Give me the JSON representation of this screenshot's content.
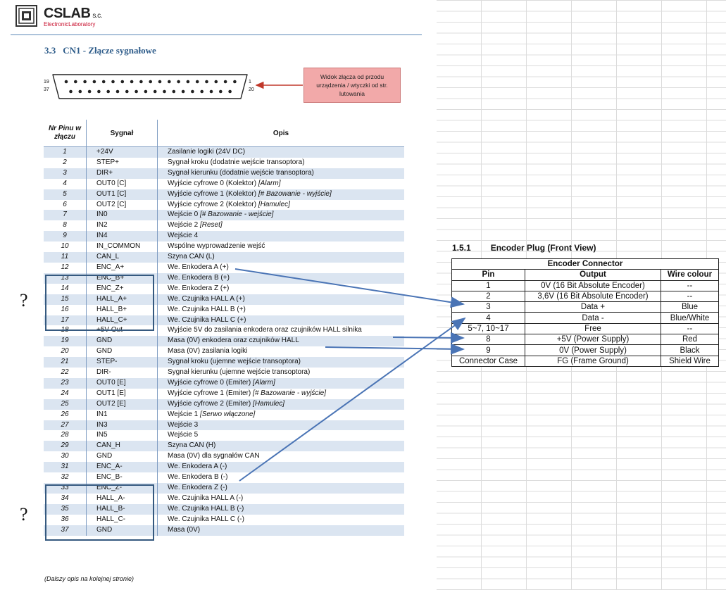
{
  "header": {
    "logo_main": "CSLAB",
    "logo_suffix": "s.c.",
    "logo_sub": "ElectronicLaboratory",
    "section_number": "3.3",
    "section_title": "CN1 - Złącze sygnałowe"
  },
  "connector": {
    "label_top_left": "19",
    "label_bottom_left": "37",
    "label_top_right": "1",
    "label_bottom_right": "20",
    "note": "Widok złącza od przodu urządzenia / wtyczki od str. lutowania",
    "top_pins": 19,
    "bottom_pins": 18
  },
  "signal_table": {
    "headers": {
      "pin": "Nr Pinu w złączu",
      "signal": "Sygnał",
      "description": "Opis"
    },
    "rows": [
      {
        "pin": "1",
        "signal": "+24V",
        "desc": "Zasilanie logiki (24V DC)",
        "extra": ""
      },
      {
        "pin": "2",
        "signal": "STEP+",
        "desc": "Sygnał kroku (dodatnie wejście transoptora)",
        "extra": ""
      },
      {
        "pin": "3",
        "signal": "DIR+",
        "desc": "Sygnał kierunku (dodatnie wejście transoptora)",
        "extra": ""
      },
      {
        "pin": "4",
        "signal": "OUT0 [C]",
        "desc": "Wyjście cyfrowe 0 (Kolektor) ",
        "extra": "[Alarm]"
      },
      {
        "pin": "5",
        "signal": "OUT1 [C]",
        "desc": "Wyjście cyfrowe 1 (Kolektor) ",
        "extra": "[# Bazowanie - wyjście]"
      },
      {
        "pin": "6",
        "signal": "OUT2 [C]",
        "desc": "Wyjście cyfrowe 2 (Kolektor) ",
        "extra": "[Hamulec]"
      },
      {
        "pin": "7",
        "signal": "IN0",
        "desc": "Wejście 0 ",
        "extra": "[# Bazowanie - wejście]"
      },
      {
        "pin": "8",
        "signal": "IN2",
        "desc": "Wejście 2 ",
        "extra": "[Reset]"
      },
      {
        "pin": "9",
        "signal": "IN4",
        "desc": "Wejście 4",
        "extra": ""
      },
      {
        "pin": "10",
        "signal": "IN_COMMON",
        "desc": "Wspólne wyprowadzenie wejść",
        "extra": ""
      },
      {
        "pin": "11",
        "signal": "CAN_L",
        "desc": "Szyna CAN (L)",
        "extra": ""
      },
      {
        "pin": "12",
        "signal": "ENC_A+",
        "desc": "We. Enkodera A (+)",
        "extra": ""
      },
      {
        "pin": "13",
        "signal": "ENC_B+",
        "desc": "We. Enkodera B (+)",
        "extra": ""
      },
      {
        "pin": "14",
        "signal": "ENC_Z+",
        "desc": "We. Enkodera Z (+)",
        "extra": ""
      },
      {
        "pin": "15",
        "signal": "HALL_A+",
        "desc": "We. Czujnika HALL A (+)",
        "extra": ""
      },
      {
        "pin": "16",
        "signal": "HALL_B+",
        "desc": "We. Czujnika HALL B (+)",
        "extra": ""
      },
      {
        "pin": "17",
        "signal": "HALL_C+",
        "desc": "We. Czujnika HALL C (+)",
        "extra": ""
      },
      {
        "pin": "18",
        "signal": "+5V Out",
        "desc": "Wyjście 5V do zasilania enkodera oraz czujników HALL silnika",
        "extra": ""
      },
      {
        "pin": "19",
        "signal": "GND",
        "desc": "Masa (0V) enkodera oraz czujników HALL",
        "extra": ""
      },
      {
        "pin": "20",
        "signal": "GND",
        "desc": "Masa (0V) zasilania logiki",
        "extra": ""
      },
      {
        "pin": "21",
        "signal": "STEP-",
        "desc": "Sygnał kroku (ujemne wejście transoptora)",
        "extra": ""
      },
      {
        "pin": "22",
        "signal": "DIR-",
        "desc": "Sygnał kierunku (ujemne wejście transoptora)",
        "extra": ""
      },
      {
        "pin": "23",
        "signal": "OUT0 [E]",
        "desc": "Wyjście cyfrowe 0 (Emiter) ",
        "extra": "[Alarm]"
      },
      {
        "pin": "24",
        "signal": "OUT1 [E]",
        "desc": "Wyjście cyfrowe 1 (Emiter) ",
        "extra": "[# Bazowanie - wyjście]"
      },
      {
        "pin": "25",
        "signal": "OUT2 [E]",
        "desc": "Wyjście cyfrowe 2 (Emiter) ",
        "extra": "[Hamulec]"
      },
      {
        "pin": "26",
        "signal": "IN1",
        "desc": "Wejście 1 ",
        "extra": "[Serwo włączone]"
      },
      {
        "pin": "27",
        "signal": "IN3",
        "desc": "Wejście 3",
        "extra": ""
      },
      {
        "pin": "28",
        "signal": "IN5",
        "desc": "Wejście 5",
        "extra": ""
      },
      {
        "pin": "29",
        "signal": "CAN_H",
        "desc": "Szyna CAN (H)",
        "extra": ""
      },
      {
        "pin": "30",
        "signal": "GND",
        "desc": "Masa (0V) dla sygnałów CAN",
        "extra": ""
      },
      {
        "pin": "31",
        "signal": "ENC_A-",
        "desc": "We. Enkodera A (-)",
        "extra": ""
      },
      {
        "pin": "32",
        "signal": "ENC_B-",
        "desc": "We. Enkodera B (-)",
        "extra": ""
      },
      {
        "pin": "33",
        "signal": "ENC_Z-",
        "desc": "We. Enkodera Z (-)",
        "extra": ""
      },
      {
        "pin": "34",
        "signal": "HALL_A-",
        "desc": "We. Czujnika HALL A (-)",
        "extra": ""
      },
      {
        "pin": "35",
        "signal": "HALL_B-",
        "desc": "We. Czujnika HALL B (-)",
        "extra": ""
      },
      {
        "pin": "36",
        "signal": "HALL_C-",
        "desc": "We. Czujnika HALL C (-)",
        "extra": ""
      },
      {
        "pin": "37",
        "signal": "GND",
        "desc": "Masa (0V)",
        "extra": ""
      }
    ]
  },
  "footnote": "(Dalszy opis na kolejnej stronie)",
  "annotations": {
    "question_mark_1": "?",
    "question_mark_2": "?",
    "arrow_color": "#4a74b5",
    "box_color": "#35597f"
  },
  "encoder_panel": {
    "section_number": "1.5.1",
    "title": "Encoder Plug (Front View)",
    "table_caption": "Encoder Connector",
    "headers": [
      "Pin",
      "Output",
      "Wire colour"
    ],
    "rows": [
      [
        "1",
        "0V (16 Bit Absolute Encoder)",
        "--"
      ],
      [
        "2",
        "3,6V (16 Bit Absolute Encoder)",
        "--"
      ],
      [
        "3",
        "Data +",
        "Blue"
      ],
      [
        "4",
        "Data -",
        "Blue/White"
      ],
      [
        "5~7, 10~17",
        "Free",
        "--"
      ],
      [
        "8",
        "+5V (Power Supply)",
        "Red"
      ],
      [
        "9",
        "0V (Power Supply)",
        "Black"
      ],
      [
        "Connector Case",
        "FG (Frame Ground)",
        "Shield Wire"
      ]
    ]
  }
}
